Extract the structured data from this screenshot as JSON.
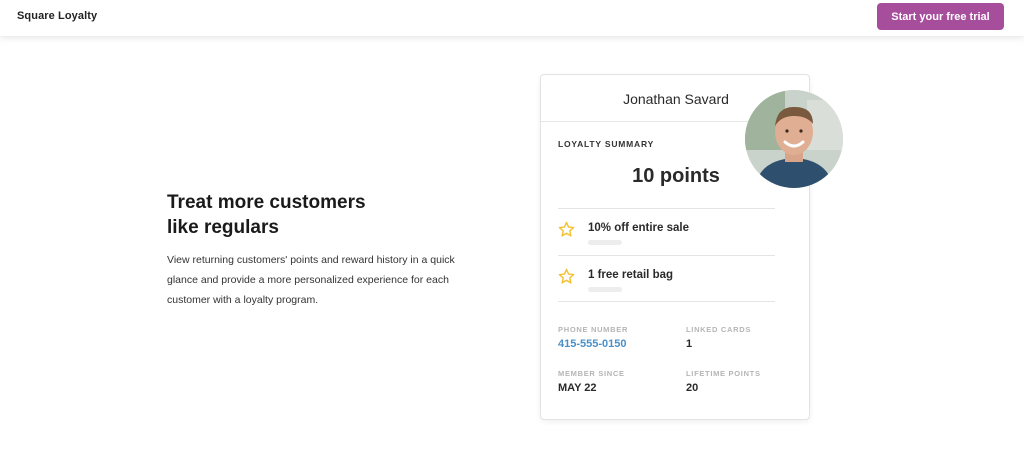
{
  "header": {
    "brand": "Square Loyalty",
    "cta_label": "Start your free trial"
  },
  "hero": {
    "title": "Treat more customers like regulars",
    "description": "View returning customers' points and reward history in a quick glance and provide a more personalized experience for each customer with a loyalty program."
  },
  "card": {
    "customer_name": "Jonathan Savard",
    "summary_label": "LOYALTY SUMMARY",
    "points": "10 points",
    "rewards": [
      {
        "label": "10% off entire sale",
        "icon": "star-icon"
      },
      {
        "label": "1 free retail bag",
        "icon": "star-icon"
      }
    ],
    "fields": {
      "phone": {
        "label": "PHONE NUMBER",
        "value": "415-555-0150"
      },
      "linked_cards": {
        "label": "LINKED CARDS",
        "value": "1"
      },
      "member_since": {
        "label": "MEMBER SINCE",
        "value": "MAY 22"
      },
      "lifetime_points": {
        "label": "LIFETIME POINTS",
        "value": "20"
      }
    }
  },
  "colors": {
    "accent": "#a64d9b",
    "link": "#4a90c8",
    "star": "#f2c232"
  }
}
